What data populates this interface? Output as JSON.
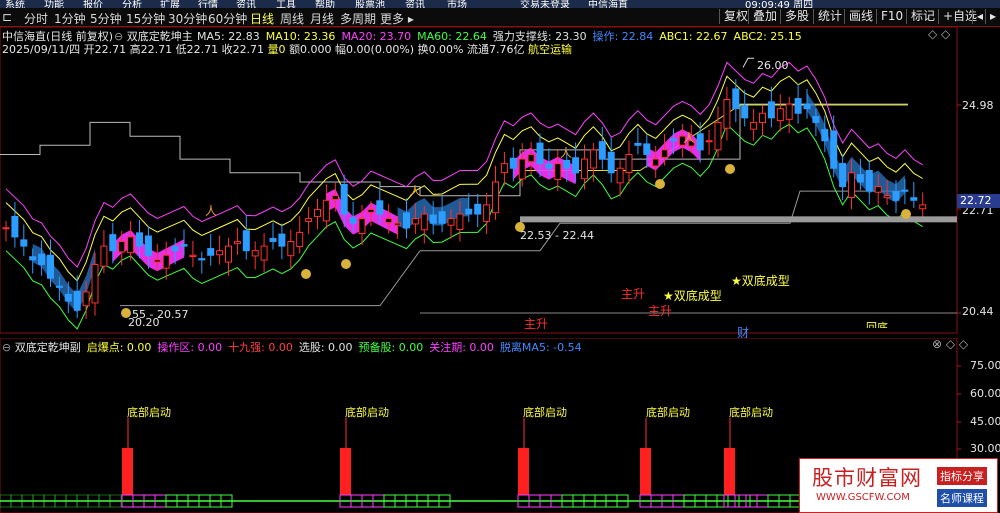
{
  "menubar": {
    "items": [
      "系统",
      "功能",
      "报价",
      "分析",
      "扩展",
      "行情",
      "资讯",
      "工具",
      "帮助",
      "股票池",
      "资讯",
      "市场",
      "交易未登录",
      "中信海直"
    ],
    "time": "09:09:49 周四"
  },
  "periods": {
    "items": [
      "分时",
      "1分钟",
      "5分钟",
      "15分钟",
      "30分钟",
      "60分钟",
      "日线",
      "周线",
      "月线",
      "多周期",
      "更多 ▸"
    ],
    "active": "日线"
  },
  "toolbar": {
    "items": [
      "复权",
      "叠加",
      "多股",
      "统计",
      "画线",
      "F10",
      "标记",
      "+自选",
      "◂",
      "▸"
    ]
  },
  "main": {
    "title": "中信海直(日线 前复权)",
    "indicator_name": "双底定乾坤主",
    "ma": [
      {
        "label": "MA5: 22.83",
        "color": "#e0e0e0"
      },
      {
        "label": "MA10: 23.36",
        "color": "#ffff40"
      },
      {
        "label": "MA20: 23.70",
        "color": "#ff40ff"
      },
      {
        "label": "MA60: 22.64",
        "color": "#40ff40"
      },
      {
        "label": "强力支撑线: 23.30",
        "color": "#e0e0e0"
      },
      {
        "label": "操作: 22.84",
        "color": "#4488ff"
      },
      {
        "label": "ABC1: 22.67",
        "color": "#ffff40"
      },
      {
        "label": "ABC2: 25.15",
        "color": "#ffff40"
      }
    ],
    "info": "2025/09/11/四 开22.71 高22.71 低22.71 收22.71",
    "info_vol": "量0",
    "info_rest": "额0.000 幅0.00(0.00%) 换0.00% 流通7.76亿",
    "info_sector": "航空运输",
    "price_labels": [
      {
        "value": "24.98"
      },
      {
        "value": "22.71"
      },
      {
        "value": "20.44"
      }
    ],
    "current_price": "22.72",
    "annotations": {
      "high": "26.00",
      "low": "20.20",
      "low_range": "55 - 20.57",
      "mid_range": "22.53 - 22.44"
    },
    "signals": [
      {
        "text": "主升"
      },
      {
        "text": "★双底成型"
      },
      {
        "text": "主升"
      },
      {
        "text": "★双底成型"
      },
      {
        "text": "主升"
      },
      {
        "text": "财"
      },
      {
        "text": "回底"
      }
    ]
  },
  "sub": {
    "indicator_name": "双底定乾坤副",
    "fields": [
      {
        "label": "启爆点: 0.00",
        "color": "#ffff40"
      },
      {
        "label": "操作区: 0.00",
        "color": "#ff40ff"
      },
      {
        "label": "十九强: 0.00",
        "color": "#ff4040"
      },
      {
        "label": "选股: 0.00",
        "color": "#e0e0e0"
      },
      {
        "label": "预备股: 0.00",
        "color": "#40ff40"
      },
      {
        "label": "关注期: 0.00",
        "color": "#ff40ff"
      },
      {
        "label": "脱离MA5: -0.54",
        "color": "#4488ff"
      }
    ],
    "levels": [
      {
        "value": "75.00"
      },
      {
        "value": "60.00"
      },
      {
        "value": "45.00"
      },
      {
        "value": "30.00"
      }
    ],
    "signals": [
      {
        "text": "底部启动"
      },
      {
        "text": "底部启动"
      },
      {
        "text": "底部启动"
      },
      {
        "text": "底部启动"
      },
      {
        "text": "底部启动"
      }
    ]
  },
  "watermark": {
    "title": "股市财富网",
    "url": "WWW.GSCFW.COM",
    "tag1": "指标分享",
    "tag2": "名师课程"
  },
  "colors": {
    "up": "#ff3030",
    "down": "#2d9cff",
    "border": "#b01818",
    "ma5": "#ffffff",
    "ma10": "#ffff40",
    "ma20": "#ff40ff",
    "ma60": "#40ff40",
    "band": "#ff33ff"
  }
}
